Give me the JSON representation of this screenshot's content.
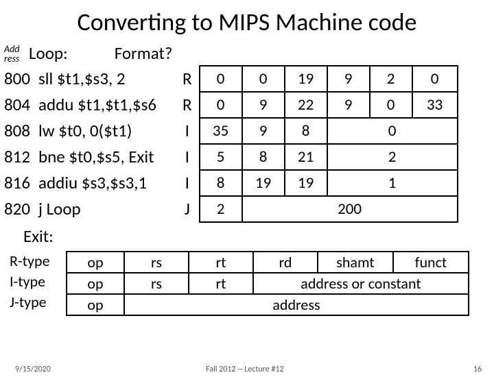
{
  "title": "Converting to MIPS Machine code",
  "labels": {
    "address": "Add\nress",
    "loop": "Loop:",
    "format": "Format?",
    "exit": "Exit:"
  },
  "rows": [
    {
      "addr": "800",
      "instr": "sll $t1,$s3, 2",
      "fmt": "R",
      "mc": [
        "0",
        "0",
        "19",
        "9",
        "2",
        "0"
      ]
    },
    {
      "addr": "804",
      "instr": "addu $t1,$t1,$s6",
      "fmt": "R",
      "mc": [
        "0",
        "9",
        "22",
        "9",
        "0",
        "33"
      ]
    },
    {
      "addr": "808",
      "instr": "lw $t0, 0($t1)",
      "fmt": "I",
      "mc": [
        "35",
        "9",
        "8",
        "0"
      ]
    },
    {
      "addr": "812",
      "instr": "bne $t0,$s5, Exit",
      "fmt": "I",
      "mc": [
        "5",
        "8",
        "21",
        "2"
      ]
    },
    {
      "addr": "816",
      "instr": "addiu $s3,$s3,1",
      "fmt": "I",
      "mc": [
        "8",
        "19",
        "19",
        "1"
      ]
    },
    {
      "addr": "820",
      "instr": "j Loop",
      "fmt": "J",
      "mc": [
        "2",
        "200"
      ]
    }
  ],
  "format_defs": {
    "types": {
      "r": "R-type",
      "i": "I-type",
      "j": "J-type"
    },
    "fields": {
      "op": "op",
      "rs": "rs",
      "rt": "rt",
      "rd": "rd",
      "shamt": "shamt",
      "funct": "funct",
      "imm": "address or constant",
      "jaddr": "address"
    }
  },
  "footer": {
    "date": "9/15/2020",
    "lecture": "Fall 2012 -- Lecture #12",
    "page": "16"
  }
}
